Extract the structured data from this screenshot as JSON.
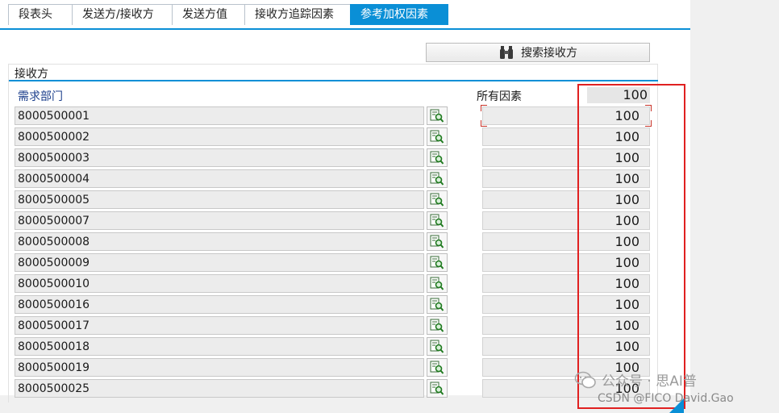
{
  "tabs": [
    {
      "label": "段表头",
      "active": false
    },
    {
      "label": "发送方/接收方",
      "active": false
    },
    {
      "label": "发送方值",
      "active": false
    },
    {
      "label": "接收方追踪因素",
      "active": false
    },
    {
      "label": "参考加权因素",
      "active": true
    }
  ],
  "search_button": {
    "label": "搜索接收方",
    "icon": "binoculars-icon"
  },
  "group": {
    "title": "接收方",
    "column_label": "需求部门",
    "all_factors_label": "所有因素",
    "all_factors_value": "100"
  },
  "rows": [
    {
      "id": "8000500001",
      "value": "100"
    },
    {
      "id": "8000500002",
      "value": "100"
    },
    {
      "id": "8000500003",
      "value": "100"
    },
    {
      "id": "8000500004",
      "value": "100"
    },
    {
      "id": "8000500005",
      "value": "100"
    },
    {
      "id": "8000500007",
      "value": "100"
    },
    {
      "id": "8000500008",
      "value": "100"
    },
    {
      "id": "8000500009",
      "value": "100"
    },
    {
      "id": "8000500010",
      "value": "100"
    },
    {
      "id": "8000500016",
      "value": "100"
    },
    {
      "id": "8000500017",
      "value": "100"
    },
    {
      "id": "8000500018",
      "value": "100"
    },
    {
      "id": "8000500019",
      "value": "100"
    },
    {
      "id": "8000500025",
      "value": "100"
    }
  ],
  "watermark": {
    "line1": "公众号 · 思AI普",
    "line2": "CSDN @FICO David.Gao"
  },
  "colors": {
    "accent": "#0a8fd6",
    "highlight": "#e02020"
  }
}
